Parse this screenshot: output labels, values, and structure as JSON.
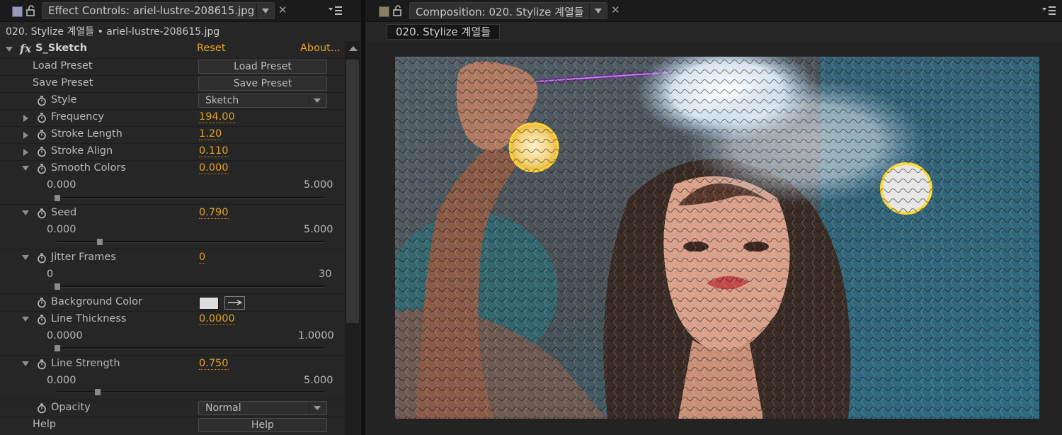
{
  "left_tab": {
    "title": "Effect Controls: ariel-lustre-208615.jpg",
    "subtitle": "020. Stylize 계열들 • ariel-lustre-208615.jpg"
  },
  "right_tab": {
    "title": "Composition: 020. Stylize 계열들",
    "subtab": "020. Stylize 계열들"
  },
  "effect": {
    "fx_icon": "fx",
    "name": "S_Sketch",
    "reset_label": "Reset",
    "about_label": "About..."
  },
  "params": {
    "load_preset": {
      "label": "Load Preset",
      "button": "Load Preset"
    },
    "save_preset": {
      "label": "Save Preset",
      "button": "Save Preset"
    },
    "style": {
      "label": "Style",
      "value": "Sketch"
    },
    "frequency": {
      "label": "Frequency",
      "value": "194.00"
    },
    "stroke_length": {
      "label": "Stroke Length",
      "value": "1.20"
    },
    "stroke_align": {
      "label": "Stroke Align",
      "value": "0.110"
    },
    "smooth_colors": {
      "label": "Smooth Colors",
      "value": "0.000",
      "min": "0.000",
      "max": "5.000",
      "level": 0.0
    },
    "seed": {
      "label": "Seed",
      "value": "0.790",
      "min": "0.000",
      "max": "5.000",
      "level": 0.158
    },
    "jitter_frames": {
      "label": "Jitter Frames",
      "value": "0",
      "min": "0",
      "max": "30",
      "level": 0.0
    },
    "background_color": {
      "label": "Background Color",
      "color": "#dcdcdc"
    },
    "line_thickness": {
      "label": "Line Thickness",
      "value": "0.0000",
      "min": "0.0000",
      "max": "1.0000",
      "level": 0.0
    },
    "line_strength": {
      "label": "Line Strength",
      "value": "0.750",
      "min": "0.000",
      "max": "5.000",
      "level": 0.15
    },
    "opacity": {
      "label": "Opacity",
      "value": "Normal"
    },
    "help": {
      "label": "Help",
      "button": "Help"
    }
  },
  "colors": {
    "value_orange": "#e3a32a",
    "panel_bg": "#262626"
  }
}
